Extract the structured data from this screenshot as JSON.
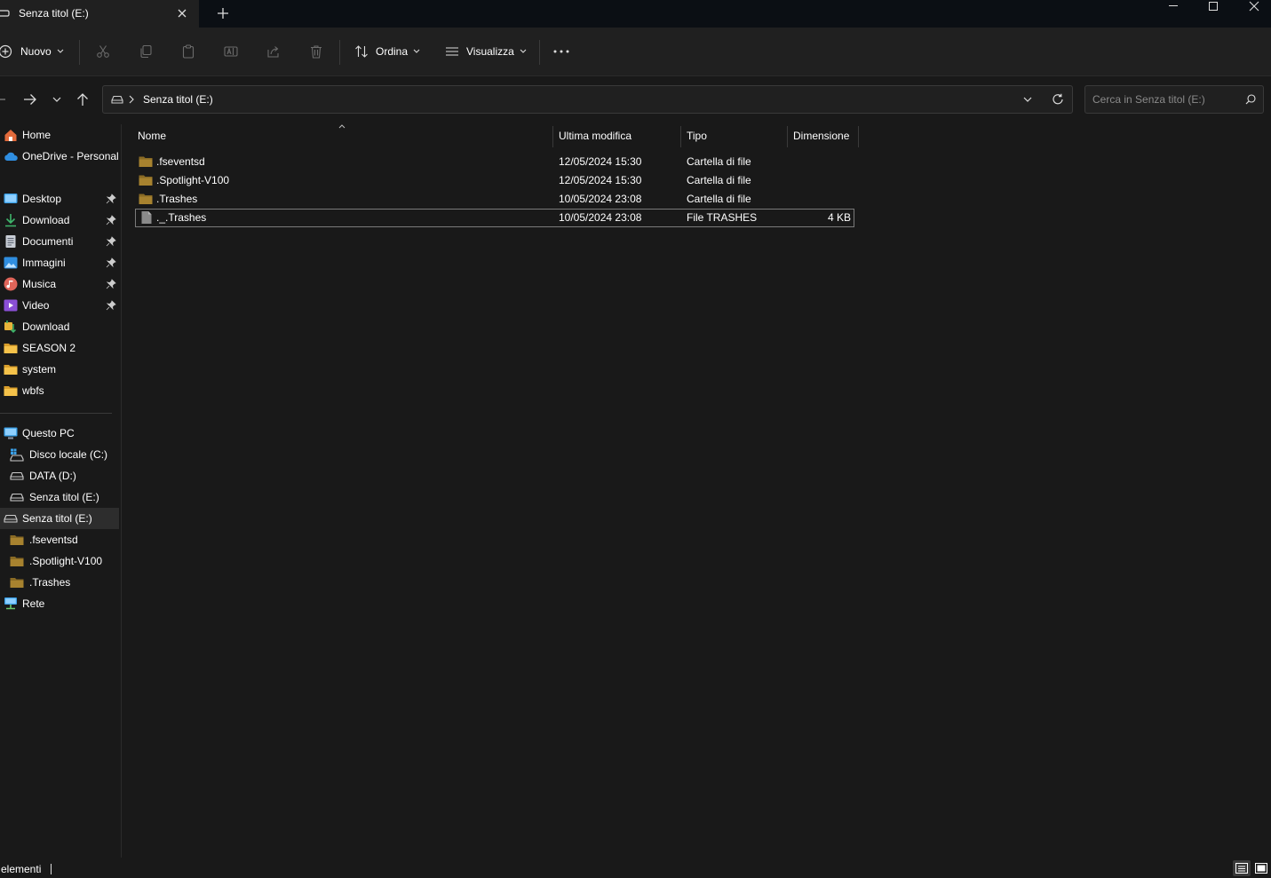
{
  "window": {
    "tab_title": "Senza titol (E:)"
  },
  "toolbar": {
    "new_label": "Nuovo",
    "sort_label": "Ordina",
    "view_label": "Visualizza"
  },
  "address": {
    "path": "Senza titol (E:)",
    "search_placeholder": "Cerca in Senza titol (E:)"
  },
  "sidebar": {
    "quick": [
      {
        "label": "Home"
      },
      {
        "label": "OneDrive - Personal"
      }
    ],
    "pinned": [
      {
        "label": "Desktop",
        "icon": "desktop-icon"
      },
      {
        "label": "Download",
        "icon": "download-icon"
      },
      {
        "label": "Documenti",
        "icon": "document-icon"
      },
      {
        "label": "Immagini",
        "icon": "pictures-icon"
      },
      {
        "label": "Musica",
        "icon": "music-icon"
      },
      {
        "label": "Video",
        "icon": "video-icon"
      }
    ],
    "recent": [
      {
        "label": "Download"
      },
      {
        "label": "SEASON 2"
      },
      {
        "label": "system"
      },
      {
        "label": "wbfs"
      }
    ],
    "pc": {
      "label": "Questo PC",
      "drives": [
        {
          "label": "Disco locale (C:)"
        },
        {
          "label": "DATA (D:)"
        },
        {
          "label": "Senza titol (E:)"
        }
      ]
    },
    "expanded": {
      "label": "Senza titol (E:)",
      "children": [
        {
          "label": ".fseventsd"
        },
        {
          "label": ".Spotlight-V100"
        },
        {
          "label": ".Trashes"
        }
      ]
    },
    "network": {
      "label": "Rete"
    }
  },
  "columns": {
    "name": "Nome",
    "modified": "Ultima modifica",
    "type": "Tipo",
    "size": "Dimensione"
  },
  "files": [
    {
      "name": ".fseventsd",
      "modified": "12/05/2024 15:30",
      "type": "Cartella di file",
      "size": "",
      "kind": "folder"
    },
    {
      "name": ".Spotlight-V100",
      "modified": "12/05/2024 15:30",
      "type": "Cartella di file",
      "size": "",
      "kind": "folder"
    },
    {
      "name": ".Trashes",
      "modified": "10/05/2024 23:08",
      "type": "Cartella di file",
      "size": "",
      "kind": "folder"
    },
    {
      "name": "._.Trashes",
      "modified": "10/05/2024 23:08",
      "type": "File TRASHES",
      "size": "4 KB",
      "kind": "file"
    }
  ],
  "status": {
    "text": "elementi"
  }
}
